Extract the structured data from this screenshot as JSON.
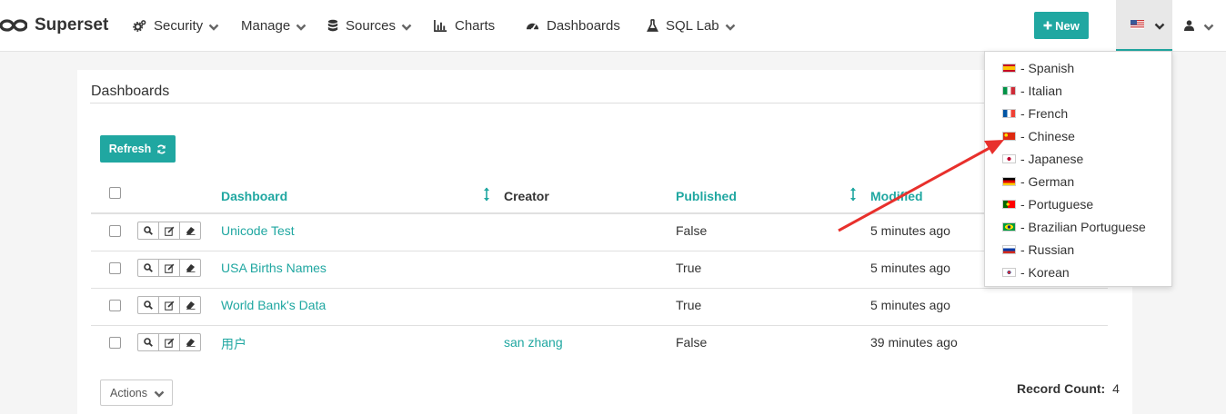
{
  "navbar": {
    "brand": "Superset",
    "items": [
      {
        "label": "Security",
        "icon": "cogs-icon",
        "dropdown": true
      },
      {
        "label": "Manage",
        "icon": "",
        "dropdown": true
      },
      {
        "label": "Sources",
        "icon": "database-icon",
        "dropdown": true
      },
      {
        "label": "Charts",
        "icon": "bar-chart-icon",
        "dropdown": false
      },
      {
        "label": "Dashboards",
        "icon": "dashboard-icon",
        "dropdown": false
      },
      {
        "label": "SQL Lab",
        "icon": "flask-icon",
        "dropdown": true
      }
    ],
    "new_button": "New",
    "language_flag": "us-flag-icon",
    "user_icon": "user-icon"
  },
  "panel": {
    "title": "Dashboards",
    "refresh_label": "Refresh",
    "columns": [
      "Dashboard",
      "Creator",
      "Published",
      "Modified"
    ],
    "rows": [
      {
        "dashboard": "Unicode Test",
        "creator": "",
        "published": "False",
        "modified": "5 minutes ago"
      },
      {
        "dashboard": "USA Births Names",
        "creator": "",
        "published": "True",
        "modified": "5 minutes ago"
      },
      {
        "dashboard": "World Bank's Data",
        "creator": "",
        "published": "True",
        "modified": "5 minutes ago"
      },
      {
        "dashboard": "用户",
        "creator": "san zhang",
        "published": "False",
        "modified": "39 minutes ago"
      }
    ],
    "actions_label": "Actions",
    "record_count_label": "Record Count:",
    "record_count": "4"
  },
  "language_menu": {
    "items": [
      {
        "label": "- Spanish",
        "flag": "spain-flag-icon"
      },
      {
        "label": "- Italian",
        "flag": "italy-flag-icon"
      },
      {
        "label": "- French",
        "flag": "france-flag-icon"
      },
      {
        "label": "- Chinese",
        "flag": "china-flag-icon"
      },
      {
        "label": "- Japanese",
        "flag": "japan-flag-icon"
      },
      {
        "label": "- German",
        "flag": "germany-flag-icon"
      },
      {
        "label": "- Portuguese",
        "flag": "portugal-flag-icon"
      },
      {
        "label": "- Brazilian Portuguese",
        "flag": "brazil-flag-icon"
      },
      {
        "label": "- Russian",
        "flag": "russia-flag-icon"
      },
      {
        "label": "- Korean",
        "flag": "korea-flag-icon"
      }
    ]
  },
  "colors": {
    "accent": "#20a7a1",
    "annotation_arrow": "#e8302c"
  }
}
